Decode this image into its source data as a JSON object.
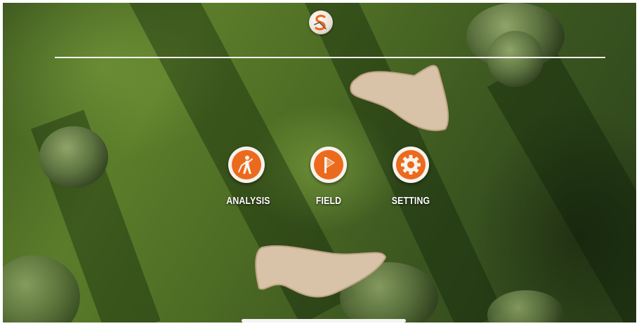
{
  "app": {
    "logo_icon": "s-logo-icon"
  },
  "menu": {
    "items": [
      {
        "label": "ANALYSIS",
        "icon": "golfer-swing-icon"
      },
      {
        "label": "FIELD",
        "icon": "flag-icon"
      },
      {
        "label": "SETTING",
        "icon": "gear-icon"
      }
    ]
  },
  "colors": {
    "accent": "#ec6a1d",
    "icon_ring": "#f7f3ec",
    "label_text": "#ffffff"
  }
}
